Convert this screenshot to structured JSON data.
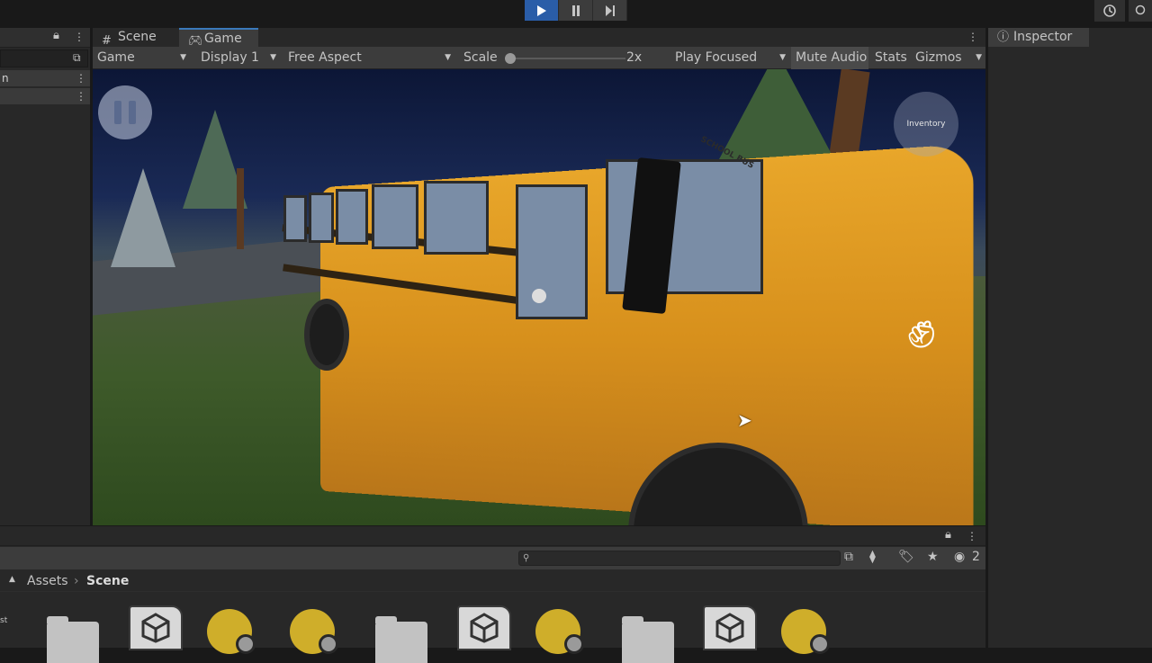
{
  "toolbar": {
    "play_label": "Play",
    "pause_label": "Pause",
    "step_label": "Step"
  },
  "game_view": {
    "tabs": [
      {
        "label": "Scene",
        "icon": "grid-icon"
      },
      {
        "label": "Game",
        "icon": "gamepad-icon"
      }
    ],
    "controls": {
      "view_mode": "Game",
      "display": "Display 1",
      "aspect": "Free Aspect",
      "scale_label": "Scale",
      "scale_value": "2x",
      "play_mode": "Play Focused",
      "mute_audio": "Mute Audio",
      "stats": "Stats",
      "gizmos": "Gizmos"
    },
    "scene": {
      "inventory_label": "Inventory",
      "bus_sign": "SCHOOL BUS"
    }
  },
  "inspector": {
    "tab_label": "Inspector"
  },
  "hierarchy": {
    "row_label": "n"
  },
  "project": {
    "breadcrumb": [
      "Assets",
      "Scene"
    ],
    "hidden_count": "2",
    "side_label": "st"
  },
  "colors": {
    "play_active": "#2a5da8",
    "tab_accent": "#3a79bb",
    "bus_yellow": "#e8a62a"
  }
}
